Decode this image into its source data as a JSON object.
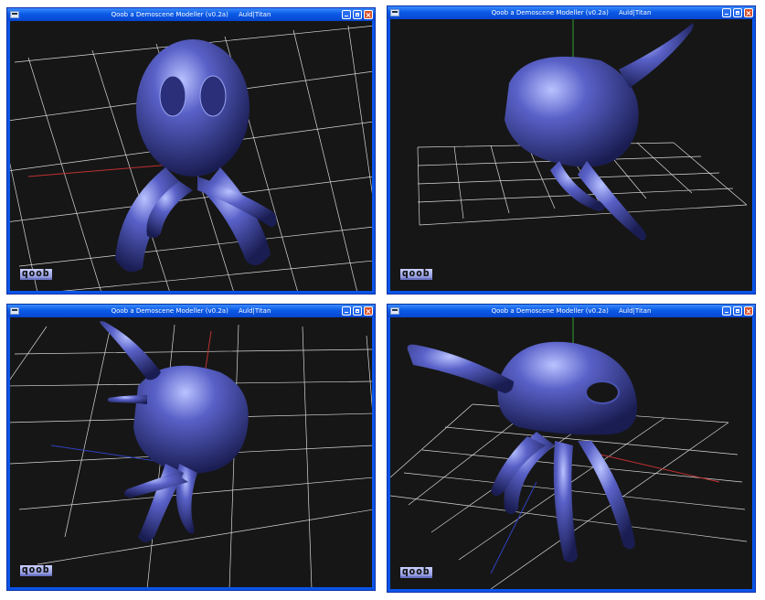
{
  "windows": [
    {
      "title": "Qoob a Demoscene Modeller (v0.2a)     Auld|Titan",
      "logo": "qoob"
    },
    {
      "title": "Qoob a Demoscene Modeller (v0.2a)     Auld|Titan",
      "logo": "qoob"
    },
    {
      "title": "Qoob a Demoscene Modeller (v0.2a)     Auld|Titan",
      "logo": "qoob"
    },
    {
      "title": "Qoob a Demoscene Modeller (v0.2a)     Auld|Titan",
      "logo": "qoob"
    }
  ],
  "colors": {
    "titlebar": "#0b5ae6",
    "viewport_bg": "#161616",
    "grid": "#d8d8d8",
    "model": "#3a3f9a",
    "axis_x": "#c03030",
    "axis_y": "#30a030",
    "axis_z": "#3040c0"
  },
  "icons": [
    "app-icon",
    "minimize-icon",
    "maximize-icon",
    "close-icon"
  ]
}
